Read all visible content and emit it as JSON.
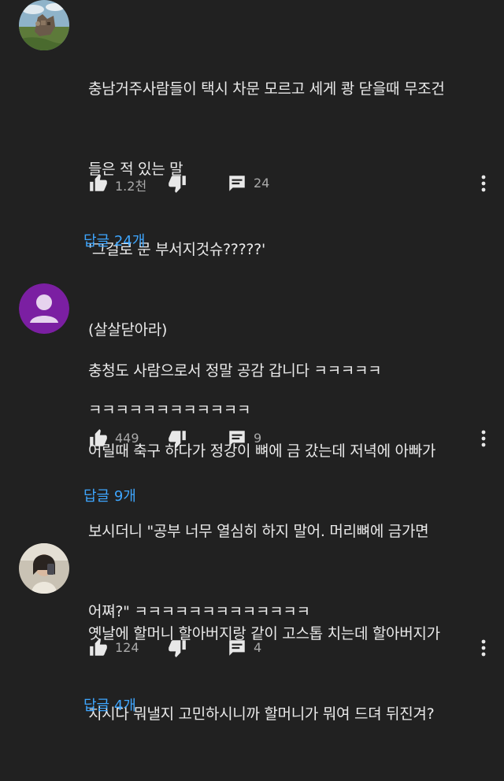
{
  "comments": [
    {
      "avatar": "castle-landscape-avatar",
      "lines": [
        "충남거주사람들이 택시 차문 모르고 세게 쾅 닫을때 무조건",
        "들은 적 있는 말",
        "'그걸로 문 부서지것슈?????'",
        "(살살닫아라)",
        "ㅋㅋㅋㅋㅋㅋㅋㅋㅋㅋㅋㅋ"
      ],
      "likes": "1.2천",
      "reply_count": "24",
      "replies_label": "답글 24개"
    },
    {
      "avatar": "default-user-avatar",
      "avatar_color": "#7b1fa2",
      "lines": [
        "충청도 사람으로서 정말 공감 갑니다 ㅋㅋㅋㅋㅋ",
        "어릴때 축구 하다가 정강이 뼈에 금 갔는데 저녁에 아빠가",
        "보시더니 \"공부 너무 열심히 하지 말어. 머리뼈에 금가면",
        "어쪄?\" ㅋㅋㅋㅋㅋㅋㅋㅋㅋㅋㅋㅋㅋ"
      ],
      "likes": "449",
      "reply_count": "9",
      "replies_label": "답글 9개"
    },
    {
      "avatar": "person-photo-avatar",
      "lines": [
        "옛날에 할머니 할아버지랑 같이 고스톱 치는데 할아버지가",
        "치시다 뭐낼지 고민하시니까 할머니가 뭐여 드뎌 뒤진겨?"
      ],
      "likes": "124",
      "reply_count": "4",
      "replies_label": "답글 4개"
    }
  ],
  "colors": {
    "background": "#212121",
    "text": "#eaeaea",
    "secondary": "#aaaaaa",
    "link": "#3ea6ff"
  }
}
